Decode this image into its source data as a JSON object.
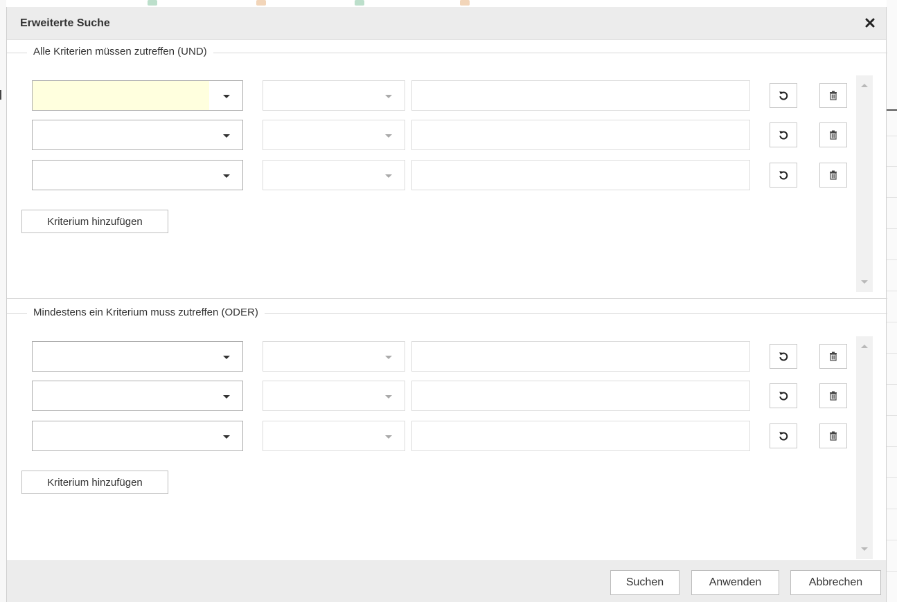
{
  "dialog": {
    "title": "Erweiterte Suche"
  },
  "and_section": {
    "legend": "Alle Kriterien müssen zutreffen (UND)",
    "add_button": "Kriterium hinzufügen"
  },
  "or_section": {
    "legend": "Mindestens ein Kriterium muss zutreffen (ODER)",
    "add_button": "Kriterium hinzufügen"
  },
  "footer": {
    "search_label": "Suchen",
    "apply_label": "Anwenden",
    "cancel_label": "Abbrechen"
  },
  "icons": {
    "close": "close-icon",
    "dropdown": "chevron-down-icon",
    "reset": "undo-icon",
    "delete": "trash-icon",
    "scroll_up": "arrow-up-icon",
    "scroll_down": "arrow-down-icon"
  },
  "colors": {
    "titlebar": "#ececec",
    "highlight_field": "#ffffde",
    "border": "#adadad"
  }
}
